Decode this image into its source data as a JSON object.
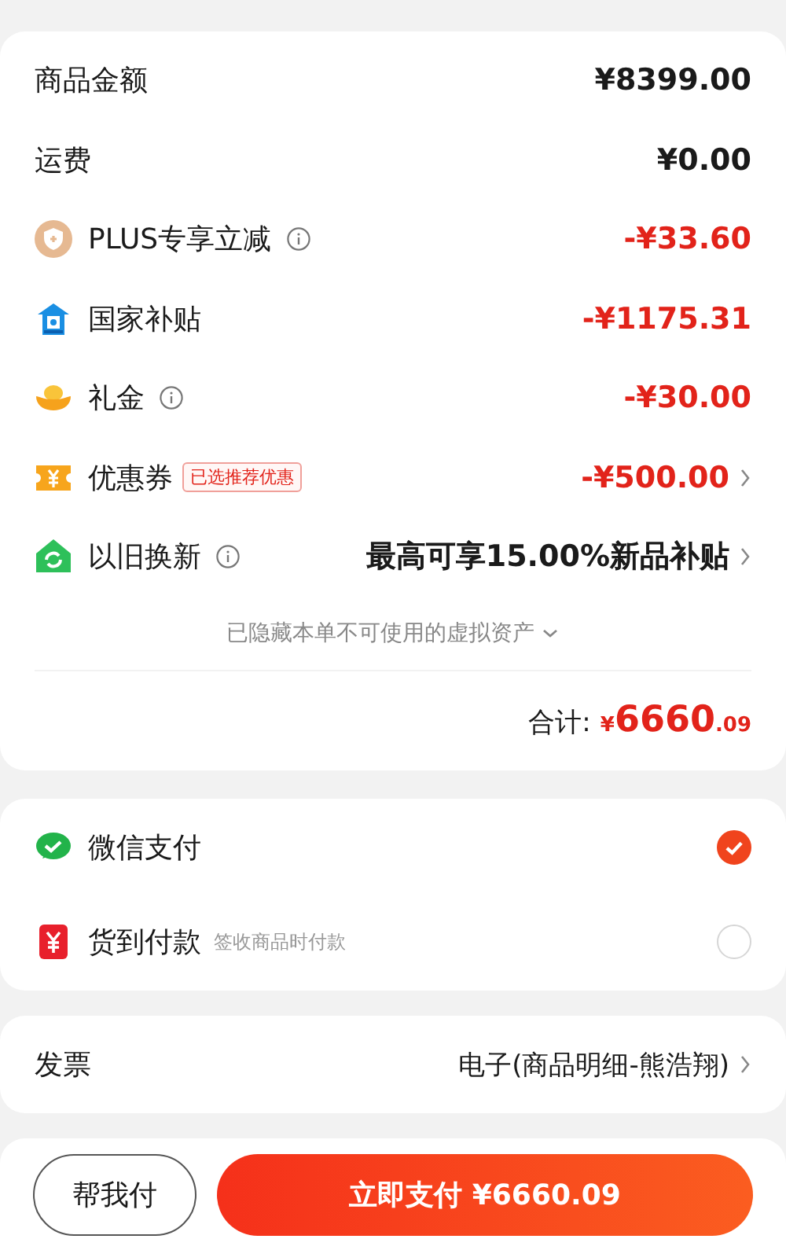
{
  "price_rows": [
    {
      "kind": "none",
      "label": "商品金额",
      "info": false,
      "value": "¥8399.00",
      "discount": false,
      "chevron": false
    },
    {
      "kind": "none",
      "label": "运费",
      "info": false,
      "value": "¥0.00",
      "discount": false,
      "chevron": false
    },
    {
      "kind": "plus",
      "label": "PLUS专享立减",
      "info": true,
      "value": "-¥33.60",
      "discount": true,
      "chevron": false
    },
    {
      "kind": "house",
      "label": "国家补贴",
      "info": false,
      "value": "-¥1175.31",
      "discount": true,
      "chevron": false
    },
    {
      "kind": "ingot",
      "label": "礼金",
      "info": true,
      "value": "-¥30.00",
      "discount": true,
      "chevron": false
    },
    {
      "kind": "coupon",
      "label": "优惠券",
      "tag": "已选推荐优惠",
      "info": false,
      "value": "-¥500.00",
      "discount": true,
      "chevron": true
    },
    {
      "kind": "tradein",
      "label": "以旧换新",
      "info": true,
      "value": "最高可享15.00%新品补贴",
      "discount": false,
      "chevron": true
    }
  ],
  "hidden_assets_note": "已隐藏本单不可使用的虚拟资产",
  "total": {
    "label": "合计:",
    "currency": "¥",
    "integer": "6660",
    "decimal": ".09"
  },
  "payment_methods": [
    {
      "kind": "wechat",
      "label": "微信支付",
      "selected": true
    },
    {
      "kind": "cod",
      "label": "货到付款",
      "hint": "签收商品时付款",
      "selected": false
    }
  ],
  "invoice": {
    "label": "发票",
    "value": "电子(商品明细-熊浩翔)"
  },
  "footer": {
    "secondary_button": "帮我付",
    "primary_button": "立即支付 ¥6660.09"
  }
}
